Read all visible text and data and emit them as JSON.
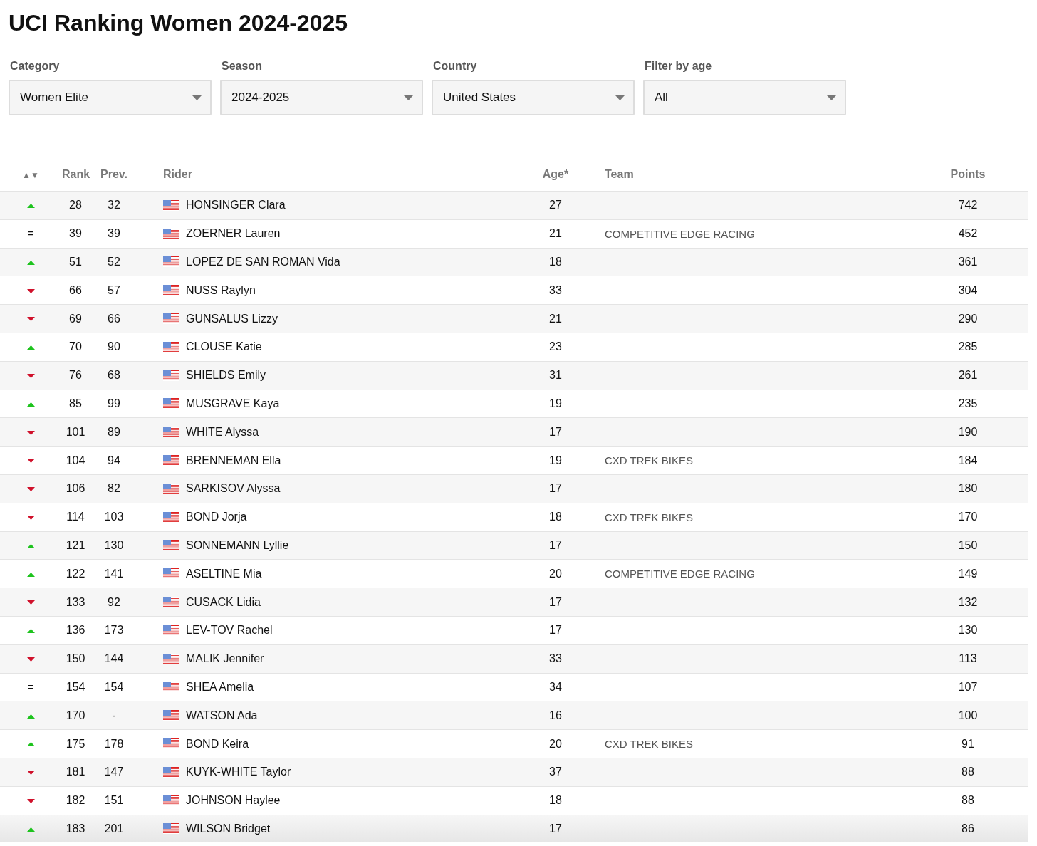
{
  "title": "UCI Ranking Women 2024-2025",
  "filters": [
    {
      "label": "Category",
      "value": "Women Elite"
    },
    {
      "label": "Season",
      "value": "2024-2025"
    },
    {
      "label": "Country",
      "value": "United States"
    },
    {
      "label": "Filter by age",
      "value": "All"
    }
  ],
  "table": {
    "columns": [
      "▲▼",
      "Rank",
      "Prev.",
      "Rider",
      "Age*",
      "Team",
      "Points"
    ],
    "rows": [
      {
        "kind": "up",
        "rank": "28",
        "prev": "32",
        "rider": "HONSINGER Clara",
        "age": "27",
        "points": "742"
      },
      {
        "kind": "same",
        "mark": "=",
        "rank": "39",
        "prev": "39",
        "rider": "ZOERNER Lauren",
        "age": "21",
        "team": "COMPETITIVE EDGE RACING",
        "points": "452"
      },
      {
        "kind": "up",
        "rank": "51",
        "prev": "52",
        "rider": "LOPEZ DE SAN ROMAN Vida",
        "age": "18",
        "points": "361"
      },
      {
        "kind": "down",
        "rank": "66",
        "prev": "57",
        "rider": "NUSS Raylyn",
        "age": "33",
        "points": "304"
      },
      {
        "kind": "down",
        "rank": "69",
        "prev": "66",
        "rider": "GUNSALUS Lizzy",
        "age": "21",
        "points": "290"
      },
      {
        "kind": "up",
        "rank": "70",
        "prev": "90",
        "rider": "CLOUSE Katie",
        "age": "23",
        "points": "285"
      },
      {
        "kind": "down",
        "rank": "76",
        "prev": "68",
        "rider": "SHIELDS Emily",
        "age": "31",
        "points": "261"
      },
      {
        "kind": "up",
        "rank": "85",
        "prev": "99",
        "rider": "MUSGRAVE Kaya",
        "age": "19",
        "points": "235"
      },
      {
        "kind": "down",
        "rank": "101",
        "prev": "89",
        "rider": "WHITE Alyssa",
        "age": "17",
        "points": "190"
      },
      {
        "kind": "down",
        "rank": "104",
        "prev": "94",
        "rider": "BRENNEMAN Ella",
        "age": "19",
        "team": "CXD TREK BIKES",
        "points": "184"
      },
      {
        "kind": "down",
        "rank": "106",
        "prev": "82",
        "rider": "SARKISOV Alyssa",
        "age": "17",
        "points": "180"
      },
      {
        "kind": "down",
        "rank": "114",
        "prev": "103",
        "rider": "BOND Jorja",
        "age": "18",
        "team": "CXD TREK BIKES",
        "points": "170"
      },
      {
        "kind": "up",
        "rank": "121",
        "prev": "130",
        "rider": "SONNEMANN Lyllie",
        "age": "17",
        "points": "150"
      },
      {
        "kind": "up",
        "rank": "122",
        "prev": "141",
        "rider": "ASELTINE Mia",
        "age": "20",
        "team": "COMPETITIVE EDGE RACING",
        "points": "149"
      },
      {
        "kind": "down",
        "rank": "133",
        "prev": "92",
        "rider": "CUSACK Lidia",
        "age": "17",
        "points": "132"
      },
      {
        "kind": "up",
        "rank": "136",
        "prev": "173",
        "rider": "LEV-TOV Rachel",
        "age": "17",
        "points": "130"
      },
      {
        "kind": "down",
        "rank": "150",
        "prev": "144",
        "rider": "MALIK Jennifer",
        "age": "33",
        "points": "113"
      },
      {
        "kind": "same",
        "mark": "=",
        "rank": "154",
        "prev": "154",
        "rider": "SHEA Amelia",
        "age": "34",
        "points": "107"
      },
      {
        "kind": "up",
        "rank": "170",
        "prev": "-",
        "rider": "WATSON Ada",
        "age": "16",
        "points": "100"
      },
      {
        "kind": "up",
        "rank": "175",
        "prev": "178",
        "rider": "BOND Keira",
        "age": "20",
        "team": "CXD TREK BIKES",
        "points": "91"
      },
      {
        "kind": "down",
        "rank": "181",
        "prev": "147",
        "rider": "KUYK-WHITE Taylor",
        "age": "37",
        "points": "88"
      },
      {
        "kind": "down",
        "rank": "182",
        "prev": "151",
        "rider": "JOHNSON Haylee",
        "age": "18",
        "points": "88"
      },
      {
        "kind": "up",
        "rank": "183",
        "prev": "201",
        "rider": "WILSON Bridget",
        "age": "17",
        "points": "86"
      }
    ]
  }
}
